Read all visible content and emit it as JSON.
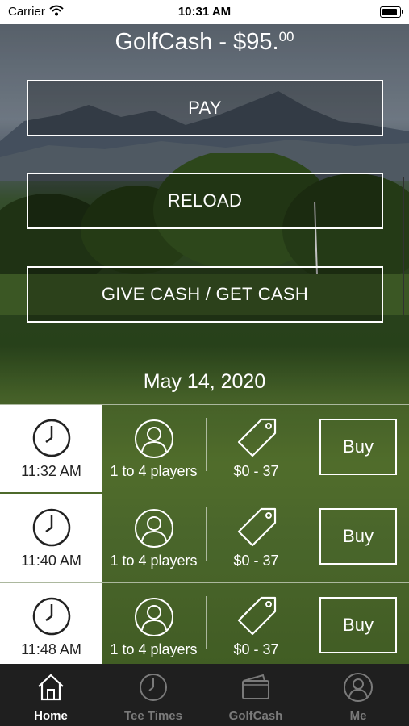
{
  "status_bar": {
    "carrier": "Carrier",
    "time": "10:31 AM",
    "battery_level": 0.9
  },
  "header": {
    "title": "GolfCash - $95.",
    "cents": "00"
  },
  "actions": {
    "pay": "PAY",
    "reload": "RELOAD",
    "give_get": "GIVE CASH / GET CASH"
  },
  "date": "May 14, 2020",
  "tee_times": [
    {
      "time": "11:32 AM",
      "players": "1 to 4 players",
      "price": "$0 - 37",
      "buy": "Buy"
    },
    {
      "time": "11:40 AM",
      "players": "1 to 4 players",
      "price": "$0 - 37",
      "buy": "Buy"
    },
    {
      "time": "11:48 AM",
      "players": "1 to 4 players",
      "price": "$0 - 37",
      "buy": "Buy"
    }
  ],
  "tabs": [
    {
      "label": "Home",
      "icon": "home-icon",
      "active": true
    },
    {
      "label": "Tee Times",
      "icon": "clock-icon",
      "active": false
    },
    {
      "label": "GolfCash",
      "icon": "wallet-icon",
      "active": false
    },
    {
      "label": "Me",
      "icon": "user-icon",
      "active": false
    }
  ],
  "colors": {
    "accent": "#ffffff",
    "tabbar": "#1f1f1f",
    "inactive_tab": "#7a7a7a"
  }
}
